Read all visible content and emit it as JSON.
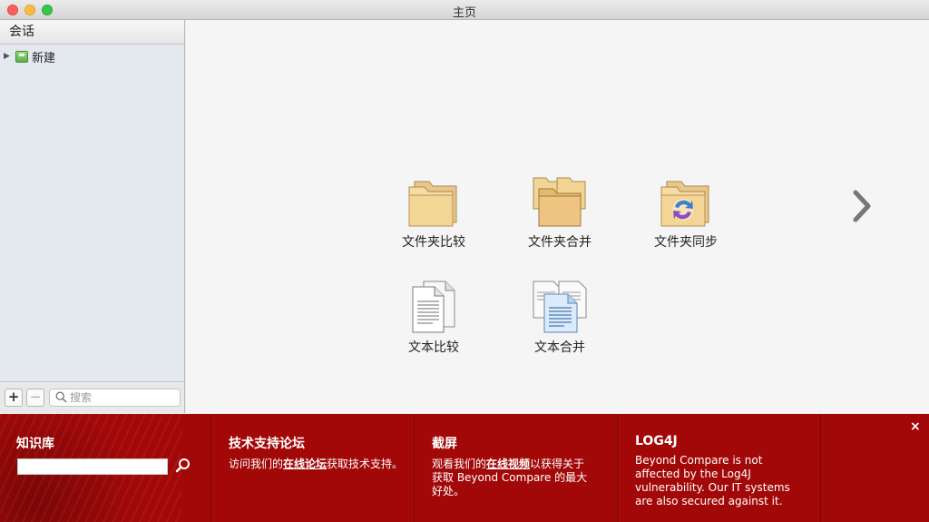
{
  "window": {
    "title": "主页"
  },
  "sidebar": {
    "header": "会话",
    "tree": [
      {
        "label": "新建",
        "icon": "session-icon"
      }
    ],
    "footer": {
      "add": "+",
      "remove": "−",
      "search_placeholder": "搜索"
    }
  },
  "main": {
    "tiles": [
      {
        "label": "文件夹比较",
        "icon": "folder-compare-icon"
      },
      {
        "label": "文件夹合并",
        "icon": "folder-merge-icon"
      },
      {
        "label": "文件夹同步",
        "icon": "folder-sync-icon"
      },
      {
        "label": "文本比较",
        "icon": "text-compare-icon"
      },
      {
        "label": "文本合并",
        "icon": "text-merge-icon"
      }
    ],
    "next_icon": "chevron-right-icon"
  },
  "banner": {
    "kb": {
      "title": "知识库"
    },
    "forum": {
      "title": "技术支持论坛",
      "pre": "访问我们的",
      "link": "在线论坛",
      "post": "获取技术支持。"
    },
    "screencast": {
      "title": "截屏",
      "pre": "观看我们的",
      "link": "在线视频",
      "post": "以获得关于获取 Beyond Compare 的最大好处。"
    },
    "log4j": {
      "title": "LOG4J",
      "text": "Beyond Compare is not affected by the Log4J vulnerability. Our IT systems are also secured against it."
    },
    "close": "×",
    "accent": "#a30808"
  }
}
